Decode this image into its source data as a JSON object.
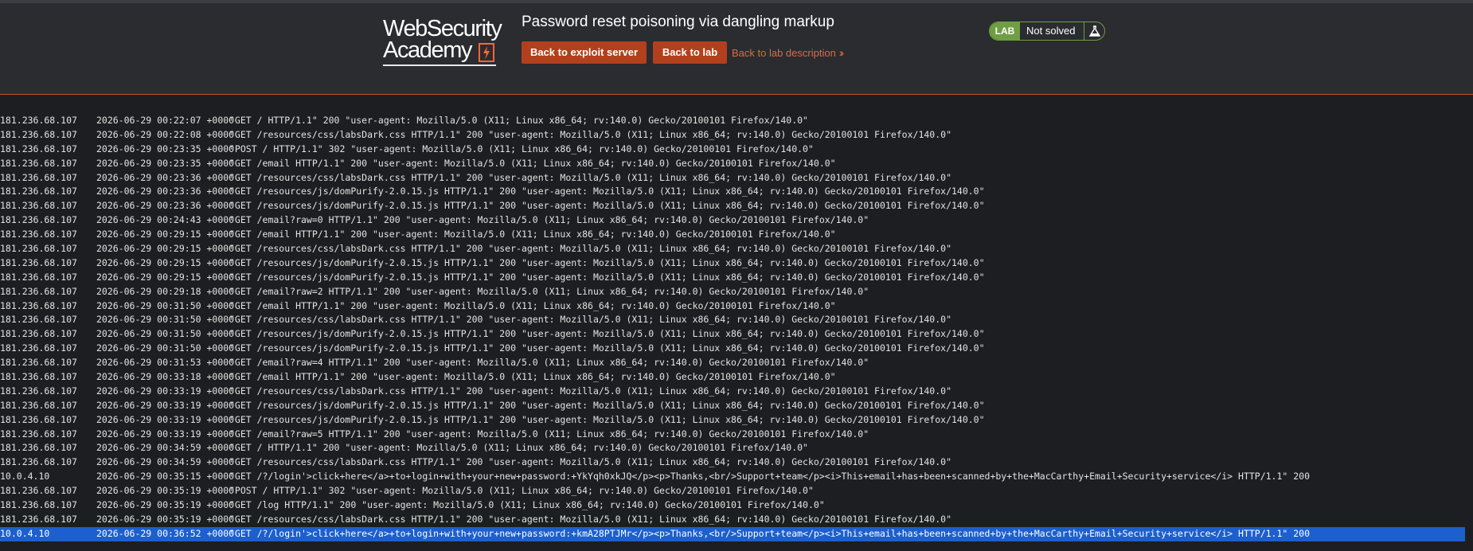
{
  "header": {
    "logo_line1": "WebSecurity",
    "logo_line2": "Academy",
    "lab_title": "Password reset poisoning via dangling markup",
    "back_exploit_label": "Back to exploit server",
    "back_lab_label": "Back to lab",
    "description_label": "Back to lab description",
    "status_badge": "LAB",
    "status_text": "Not solved"
  },
  "colors": {
    "accent": "#b2401c",
    "link": "#e26b33",
    "status_green": "#6f9e44",
    "selection": "#1c5fce"
  },
  "log": [
    {
      "ip": "181.236.68.107",
      "ts": "2026-06-29 00:22:07 +0000",
      "req": "\"GET / HTTP/1.1\" 200 \"user-agent: Mozilla/5.0 (X11; Linux x86_64; rv:140.0) Gecko/20100101 Firefox/140.0\""
    },
    {
      "ip": "181.236.68.107",
      "ts": "2026-06-29 00:22:08 +0000",
      "req": "\"GET /resources/css/labsDark.css HTTP/1.1\" 200 \"user-agent: Mozilla/5.0 (X11; Linux x86_64; rv:140.0) Gecko/20100101 Firefox/140.0\""
    },
    {
      "ip": "181.236.68.107",
      "ts": "2026-06-29 00:23:35 +0000",
      "req": "\"POST / HTTP/1.1\" 302 \"user-agent: Mozilla/5.0 (X11; Linux x86_64; rv:140.0) Gecko/20100101 Firefox/140.0\""
    },
    {
      "ip": "181.236.68.107",
      "ts": "2026-06-29 00:23:35 +0000",
      "req": "\"GET /email HTTP/1.1\" 200 \"user-agent: Mozilla/5.0 (X11; Linux x86_64; rv:140.0) Gecko/20100101 Firefox/140.0\""
    },
    {
      "ip": "181.236.68.107",
      "ts": "2026-06-29 00:23:36 +0000",
      "req": "\"GET /resources/css/labsDark.css HTTP/1.1\" 200 \"user-agent: Mozilla/5.0 (X11; Linux x86_64; rv:140.0) Gecko/20100101 Firefox/140.0\""
    },
    {
      "ip": "181.236.68.107",
      "ts": "2026-06-29 00:23:36 +0000",
      "req": "\"GET /resources/js/domPurify-2.0.15.js HTTP/1.1\" 200 \"user-agent: Mozilla/5.0 (X11; Linux x86_64; rv:140.0) Gecko/20100101 Firefox/140.0\""
    },
    {
      "ip": "181.236.68.107",
      "ts": "2026-06-29 00:23:36 +0000",
      "req": "\"GET /resources/js/domPurify-2.0.15.js HTTP/1.1\" 200 \"user-agent: Mozilla/5.0 (X11; Linux x86_64; rv:140.0) Gecko/20100101 Firefox/140.0\""
    },
    {
      "ip": "181.236.68.107",
      "ts": "2026-06-29 00:24:43 +0000",
      "req": "\"GET /email?raw=0 HTTP/1.1\" 200 \"user-agent: Mozilla/5.0 (X11; Linux x86_64; rv:140.0) Gecko/20100101 Firefox/140.0\""
    },
    {
      "ip": "181.236.68.107",
      "ts": "2026-06-29 00:29:15 +0000",
      "req": "\"GET /email HTTP/1.1\" 200 \"user-agent: Mozilla/5.0 (X11; Linux x86_64; rv:140.0) Gecko/20100101 Firefox/140.0\""
    },
    {
      "ip": "181.236.68.107",
      "ts": "2026-06-29 00:29:15 +0000",
      "req": "\"GET /resources/css/labsDark.css HTTP/1.1\" 200 \"user-agent: Mozilla/5.0 (X11; Linux x86_64; rv:140.0) Gecko/20100101 Firefox/140.0\""
    },
    {
      "ip": "181.236.68.107",
      "ts": "2026-06-29 00:29:15 +0000",
      "req": "\"GET /resources/js/domPurify-2.0.15.js HTTP/1.1\" 200 \"user-agent: Mozilla/5.0 (X11; Linux x86_64; rv:140.0) Gecko/20100101 Firefox/140.0\""
    },
    {
      "ip": "181.236.68.107",
      "ts": "2026-06-29 00:29:15 +0000",
      "req": "\"GET /resources/js/domPurify-2.0.15.js HTTP/1.1\" 200 \"user-agent: Mozilla/5.0 (X11; Linux x86_64; rv:140.0) Gecko/20100101 Firefox/140.0\""
    },
    {
      "ip": "181.236.68.107",
      "ts": "2026-06-29 00:29:18 +0000",
      "req": "\"GET /email?raw=2 HTTP/1.1\" 200 \"user-agent: Mozilla/5.0 (X11; Linux x86_64; rv:140.0) Gecko/20100101 Firefox/140.0\""
    },
    {
      "ip": "181.236.68.107",
      "ts": "2026-06-29 00:31:50 +0000",
      "req": "\"GET /email HTTP/1.1\" 200 \"user-agent: Mozilla/5.0 (X11; Linux x86_64; rv:140.0) Gecko/20100101 Firefox/140.0\""
    },
    {
      "ip": "181.236.68.107",
      "ts": "2026-06-29 00:31:50 +0000",
      "req": "\"GET /resources/css/labsDark.css HTTP/1.1\" 200 \"user-agent: Mozilla/5.0 (X11; Linux x86_64; rv:140.0) Gecko/20100101 Firefox/140.0\""
    },
    {
      "ip": "181.236.68.107",
      "ts": "2026-06-29 00:31:50 +0000",
      "req": "\"GET /resources/js/domPurify-2.0.15.js HTTP/1.1\" 200 \"user-agent: Mozilla/5.0 (X11; Linux x86_64; rv:140.0) Gecko/20100101 Firefox/140.0\""
    },
    {
      "ip": "181.236.68.107",
      "ts": "2026-06-29 00:31:50 +0000",
      "req": "\"GET /resources/js/domPurify-2.0.15.js HTTP/1.1\" 200 \"user-agent: Mozilla/5.0 (X11; Linux x86_64; rv:140.0) Gecko/20100101 Firefox/140.0\""
    },
    {
      "ip": "181.236.68.107",
      "ts": "2026-06-29 00:31:53 +0000",
      "req": "\"GET /email?raw=4 HTTP/1.1\" 200 \"user-agent: Mozilla/5.0 (X11; Linux x86_64; rv:140.0) Gecko/20100101 Firefox/140.0\""
    },
    {
      "ip": "181.236.68.107",
      "ts": "2026-06-29 00:33:18 +0000",
      "req": "\"GET /email HTTP/1.1\" 200 \"user-agent: Mozilla/5.0 (X11; Linux x86_64; rv:140.0) Gecko/20100101 Firefox/140.0\""
    },
    {
      "ip": "181.236.68.107",
      "ts": "2026-06-29 00:33:19 +0000",
      "req": "\"GET /resources/css/labsDark.css HTTP/1.1\" 200 \"user-agent: Mozilla/5.0 (X11; Linux x86_64; rv:140.0) Gecko/20100101 Firefox/140.0\""
    },
    {
      "ip": "181.236.68.107",
      "ts": "2026-06-29 00:33:19 +0000",
      "req": "\"GET /resources/js/domPurify-2.0.15.js HTTP/1.1\" 200 \"user-agent: Mozilla/5.0 (X11; Linux x86_64; rv:140.0) Gecko/20100101 Firefox/140.0\""
    },
    {
      "ip": "181.236.68.107",
      "ts": "2026-06-29 00:33:19 +0000",
      "req": "\"GET /resources/js/domPurify-2.0.15.js HTTP/1.1\" 200 \"user-agent: Mozilla/5.0 (X11; Linux x86_64; rv:140.0) Gecko/20100101 Firefox/140.0\""
    },
    {
      "ip": "181.236.68.107",
      "ts": "2026-06-29 00:33:19 +0000",
      "req": "\"GET /email?raw=5 HTTP/1.1\" 200 \"user-agent: Mozilla/5.0 (X11; Linux x86_64; rv:140.0) Gecko/20100101 Firefox/140.0\""
    },
    {
      "ip": "181.236.68.107",
      "ts": "2026-06-29 00:34:59 +0000",
      "req": "\"GET / HTTP/1.1\" 200 \"user-agent: Mozilla/5.0 (X11; Linux x86_64; rv:140.0) Gecko/20100101 Firefox/140.0\""
    },
    {
      "ip": "181.236.68.107",
      "ts": "2026-06-29 00:34:59 +0000",
      "req": "\"GET /resources/css/labsDark.css HTTP/1.1\" 200 \"user-agent: Mozilla/5.0 (X11; Linux x86_64; rv:140.0) Gecko/20100101 Firefox/140.0\""
    },
    {
      "ip": "10.0.4.10",
      "ts": "2026-06-29 00:35:15 +0000",
      "req": "\"GET /?/login'>click+here</a>+to+login+with+your+new+password:+YkYqh0xkJQ</p><p>Thanks,<br/>Support+team</p><i>This+email+has+been+scanned+by+the+MacCarthy+Email+Security+service</i> HTTP/1.1\" 200"
    },
    {
      "ip": "181.236.68.107",
      "ts": "2026-06-29 00:35:19 +0000",
      "req": "\"POST / HTTP/1.1\" 302 \"user-agent: Mozilla/5.0 (X11; Linux x86_64; rv:140.0) Gecko/20100101 Firefox/140.0\""
    },
    {
      "ip": "181.236.68.107",
      "ts": "2026-06-29 00:35:19 +0000",
      "req": "\"GET /log HTTP/1.1\" 200 \"user-agent: Mozilla/5.0 (X11; Linux x86_64; rv:140.0) Gecko/20100101 Firefox/140.0\""
    },
    {
      "ip": "181.236.68.107",
      "ts": "2026-06-29 00:35:19 +0000",
      "req": "\"GET /resources/css/labsDark.css HTTP/1.1\" 200 \"user-agent: Mozilla/5.0 (X11; Linux x86_64; rv:140.0) Gecko/20100101 Firefox/140.0\""
    },
    {
      "ip": "10.0.4.10",
      "ts": "2026-06-29 00:36:52 +0000",
      "req": "\"GET /?/login'>click+here</a>+to+login+with+your+new+password:+kmA28PTJMr</p><p>Thanks,<br/>Support+team</p><i>This+email+has+been+scanned+by+the+MacCarthy+Email+Security+service</i> HTTP/1.1\" 200",
      "selected": true
    }
  ]
}
